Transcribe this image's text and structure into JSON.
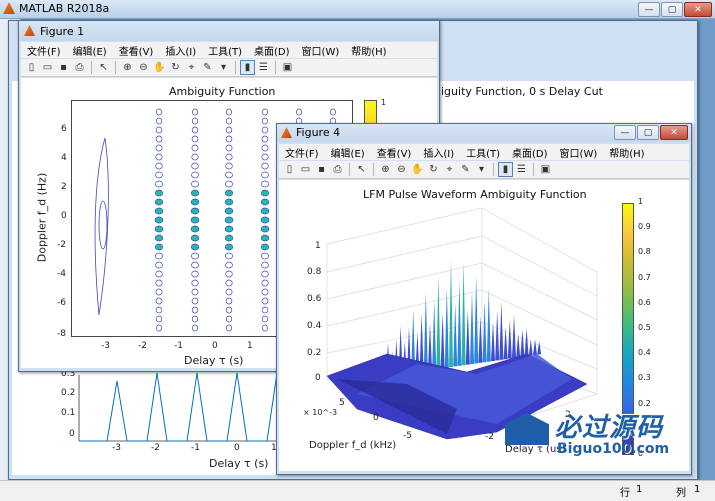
{
  "app": {
    "title": "MATLAB R2018a"
  },
  "status": {
    "row_label": "行",
    "row_value": "1",
    "col_label": "列",
    "col_value": "1"
  },
  "background_window": {
    "chart_title": "iguity Function, 0 s Delay Cut",
    "x_label": "Delay τ (s)",
    "y_ticks": [
      "0.3",
      "0.2",
      "0.1",
      "0"
    ],
    "x_ticks": [
      "-3",
      "-2",
      "-1",
      "0",
      "1"
    ]
  },
  "figure1": {
    "title": "Figure 1",
    "menu": [
      "文件(F)",
      "编辑(E)",
      "查看(V)",
      "插入(I)",
      "工具(T)",
      "桌面(D)",
      "窗口(W)",
      "帮助(H)"
    ],
    "chart_title": "Ambiguity Function",
    "x_label": "Delay τ (s)",
    "y_label": "Doppler f_d (Hz)",
    "y_ticks": [
      "6",
      "4",
      "2",
      "0",
      "-2",
      "-4",
      "-6",
      "-8"
    ],
    "x_ticks": [
      "-3",
      "-2",
      "-1",
      "0",
      "1"
    ],
    "colorbar_top": "1"
  },
  "figure4": {
    "title": "Figure 4",
    "menu": [
      "文件(F)",
      "编辑(E)",
      "查看(V)",
      "插入(I)",
      "工具(T)",
      "桌面(D)",
      "窗口(W)",
      "帮助(H)"
    ],
    "chart_title": "LFM Pulse Waveform Ambiguity Function",
    "z_ticks": [
      "1",
      "0.8",
      "0.6",
      "0.4",
      "0.2",
      "0"
    ],
    "y_axis_exponent": "× 10^-3",
    "y_ticks": [
      "5",
      "0",
      "-5"
    ],
    "y_label": "Doppler f_d (kHz)",
    "x_ticks": [
      "2",
      "0",
      "-2"
    ],
    "x_label": "Delay τ (us)",
    "colorbar_ticks": [
      "1",
      "0.9",
      "0.8",
      "0.7",
      "0.6",
      "0.5",
      "0.4",
      "0.3",
      "0.2",
      "0.1",
      "0"
    ]
  },
  "watermark": {
    "brand": "必过源码",
    "url": "Biguo100.com"
  },
  "colors": {
    "parula_top": "#f9fb0e",
    "parula_bottom": "#352a87",
    "matlab_blue": "#0072bd",
    "accent": "#1f5fa8"
  }
}
